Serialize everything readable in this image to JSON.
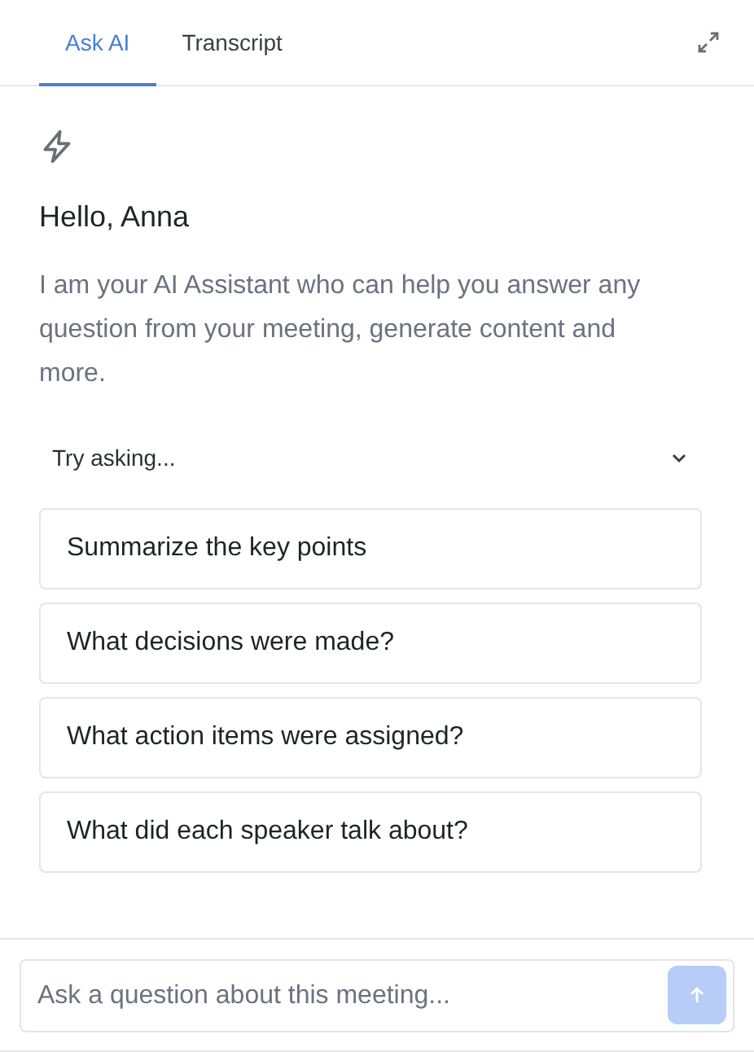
{
  "tabs": [
    {
      "label": "Ask AI",
      "selected": true
    },
    {
      "label": "Transcript",
      "selected": false
    }
  ],
  "greeting": "Hello, Anna",
  "intro": "I am your AI Assistant who can help you answer any question from your meeting, generate content and more.",
  "suggestions_header": {
    "label": "Try asking...",
    "expanded": true
  },
  "suggestions": [
    "Summarize the key points",
    "What decisions were made?",
    "What action items were assigned?",
    "What did each speaker talk about?"
  ],
  "composer": {
    "placeholder": "Ask a question about this meeting...",
    "send_disabled": true
  }
}
